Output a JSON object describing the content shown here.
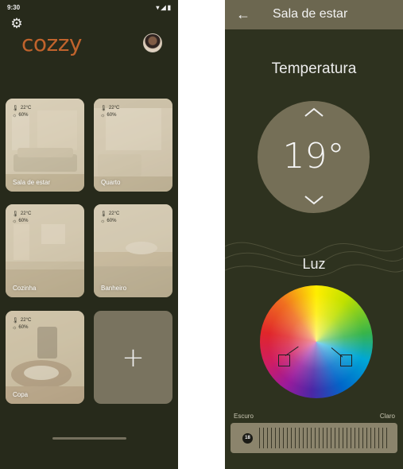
{
  "home": {
    "status": {
      "time": "9:30"
    },
    "logo": "cozzy",
    "rooms": [
      {
        "name": "Sala de estar",
        "temperature": "22°C",
        "humidity": "60%"
      },
      {
        "name": "Quarto",
        "temperature": "22°C",
        "humidity": "60%"
      },
      {
        "name": "Cozinha",
        "temperature": "22°C",
        "humidity": "60%"
      },
      {
        "name": "Banheiro",
        "temperature": "22°C",
        "humidity": "60%"
      },
      {
        "name": "Copa",
        "temperature": "22°C",
        "humidity": "60%"
      }
    ],
    "add_label": "+"
  },
  "detail": {
    "title": "Sala de estar",
    "temperature_title": "Temperatura",
    "temperature_value": "19°",
    "light_title": "Luz",
    "slider_min_label": "Escuro",
    "slider_max_label": "Claro",
    "slider_value": "18",
    "selected_colors": [
      "#e0262a",
      "#00a7d6"
    ]
  },
  "colors": {
    "home_background": "#272a1b",
    "detail_background": "#2e321f",
    "top_bar": "#6c6750",
    "card_add": "#79735f",
    "logo": "#c0632c"
  }
}
